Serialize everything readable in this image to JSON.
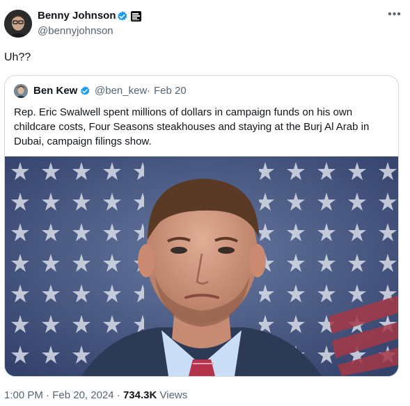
{
  "author": {
    "name": "Benny Johnson",
    "handle": "@bennyjohnson"
  },
  "tweet": {
    "text": "Uh??",
    "more_icon": "more-horizontal-icon"
  },
  "quoted": {
    "name": "Ben Kew",
    "handle": "@ben_kew",
    "separator": "·",
    "date": "Feb 20",
    "text": "Rep. Eric Swalwell spent millions of dollars in campaign funds on his own childcare costs, Four Seasons steakhouses and staying at the Burj Al Arab in Dubai, campaign filings show."
  },
  "footer": {
    "time": "1:00 PM",
    "sep1": "·",
    "date": "Feb 20, 2024",
    "sep2": "·",
    "views_count": "734.3K",
    "views_label": "Views"
  },
  "colors": {
    "verified_blue": "#1d9bf0",
    "secondary_text": "#536471",
    "border": "#cfd9de"
  }
}
